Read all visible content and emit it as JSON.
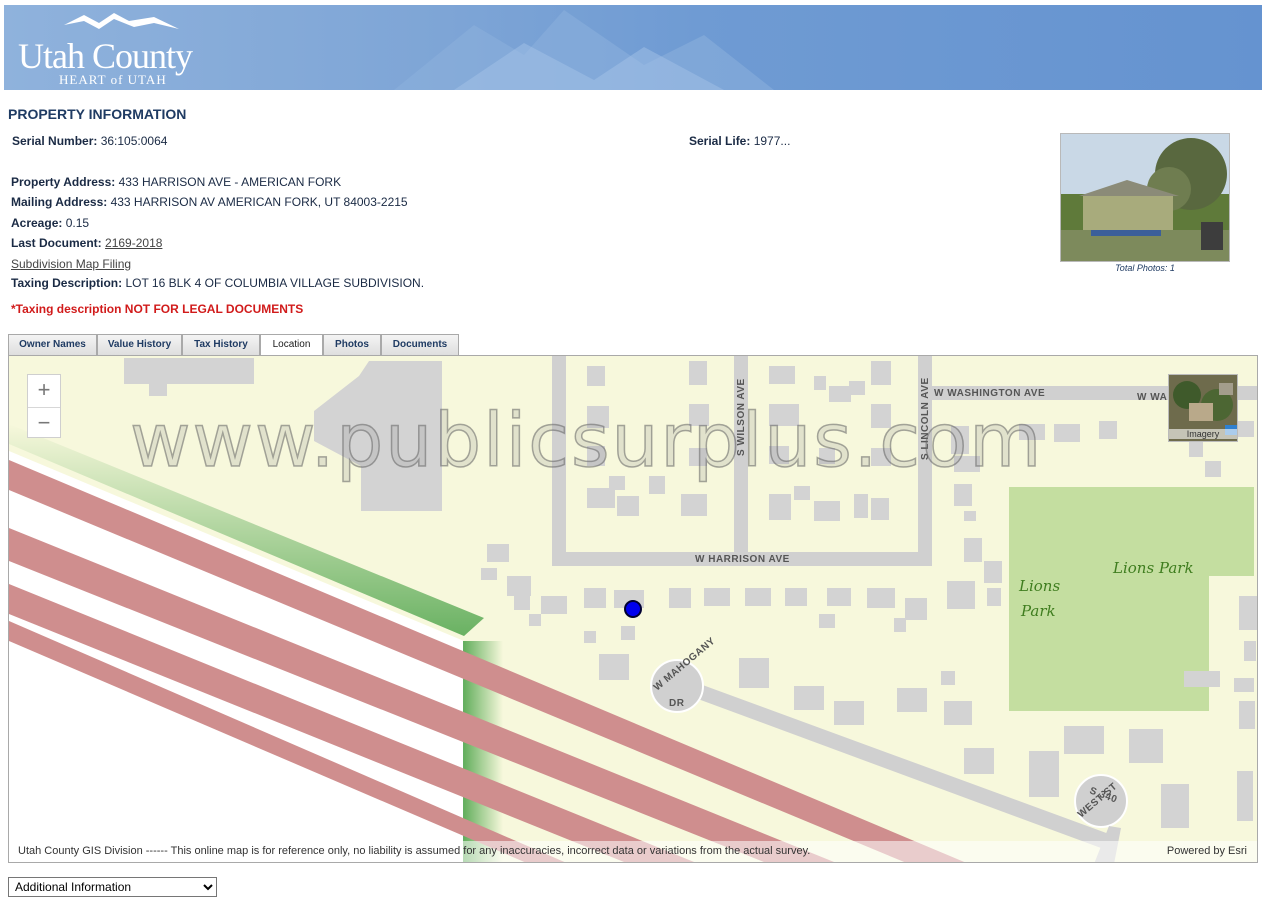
{
  "header": {
    "logo_title": "Utah County",
    "logo_subtitle": "HEART of UTAH"
  },
  "property": {
    "section_title": "PROPERTY INFORMATION",
    "serial_number_label": "Serial Number:",
    "serial_number": "36:105:0064",
    "serial_life_label": "Serial Life:",
    "serial_life": "1977...",
    "property_address_label": "Property Address:",
    "property_address": "433 HARRISON AVE - AMERICAN FORK",
    "mailing_address_label": "Mailing Address:",
    "mailing_address": "433 HARRISON AV AMERICAN FORK, UT 84003-2215",
    "acreage_label": "Acreage:",
    "acreage": "0.15",
    "last_document_label": "Last Document:",
    "last_document": "2169-2018",
    "subdivision_link": "Subdivision Map Filing",
    "taxing_description_label": "Taxing Description:",
    "taxing_description": "LOT 16 BLK 4 OF COLUMBIA VILLAGE SUBDIVISION.",
    "warning": "*Taxing description NOT FOR LEGAL DOCUMENTS",
    "photo_caption": "Total Photos: 1"
  },
  "tabs": [
    {
      "label": "Owner Names"
    },
    {
      "label": "Value History"
    },
    {
      "label": "Tax History"
    },
    {
      "label": "Location"
    },
    {
      "label": "Photos"
    },
    {
      "label": "Documents"
    }
  ],
  "active_tab": "Location",
  "map": {
    "zoom_in": "+",
    "zoom_out": "−",
    "basemap_label": "Imagery",
    "streets": {
      "washington": "W WASHINGTON AVE",
      "washington_short": "W WA",
      "wilson": "S WILSON AVE",
      "lincoln": "S LINCOLN AVE",
      "harrison": "W HARRISON AVE",
      "mahogany_1": "W MAHOGANY",
      "mahogany_2": "DR",
      "west_st_1": "S 340",
      "west_st_2": "WEST ST"
    },
    "park_labels": [
      "Lions",
      "Park",
      "Lions Park"
    ],
    "watermark": "www.publicsurplus.com",
    "attribution": "Utah County GIS Division ------ This online map is for reference only, no liability is assumed for any inaccuracies, incorrect data or variations from the actual survey.",
    "powered_by": "Powered by Esri",
    "colors": {
      "background": "#f7f8dc",
      "building": "#d3d3d3",
      "road": "#d0d0d0",
      "rail": "#cf8e8e",
      "park": "#c4dea0",
      "marker": "#0000ee"
    }
  },
  "select": {
    "selected": "Additional Information"
  }
}
